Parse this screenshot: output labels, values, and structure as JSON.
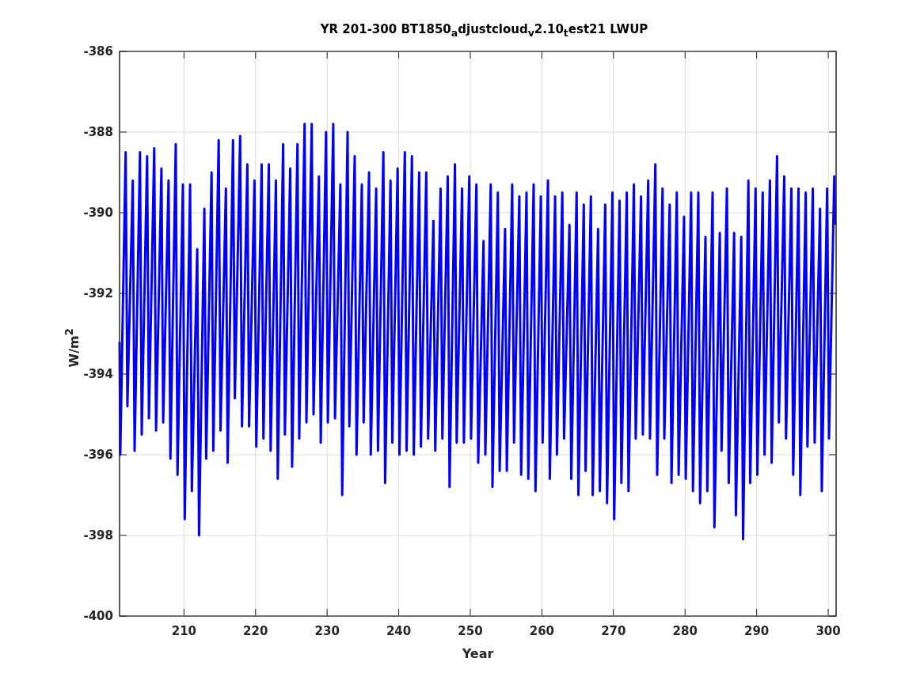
{
  "figure": {
    "chart_data": {
      "type": "line",
      "title": "YR 201-300 BT1850$_{a}$djustcloud$_{v}$2.10$_{t}$est21 LWUP",
      "xlabel": "Year",
      "ylabel": "W/m$^{2}$",
      "x": [
        201,
        201.1,
        201.85,
        202.1,
        202.85,
        203.1,
        203.85,
        204.1,
        204.85,
        205.1,
        205.85,
        206.1,
        206.85,
        207.1,
        207.85,
        208.1,
        208.85,
        209.1,
        209.85,
        210.1,
        210.85,
        211.1,
        211.85,
        212.1,
        212.85,
        213.1,
        213.85,
        214.1,
        214.85,
        215.1,
        215.85,
        216.1,
        216.85,
        217.1,
        217.85,
        218.1,
        218.85,
        219.1,
        219.85,
        220.1,
        220.85,
        221.1,
        221.85,
        222.1,
        222.85,
        223.1,
        223.85,
        224.1,
        224.85,
        225.1,
        225.85,
        226.1,
        226.85,
        227.1,
        227.85,
        228.1,
        228.85,
        229.1,
        229.85,
        230.1,
        230.85,
        231.1,
        231.85,
        232.1,
        232.85,
        233.1,
        233.85,
        234.1,
        234.85,
        235.1,
        235.85,
        236.1,
        236.85,
        237.1,
        237.85,
        238.1,
        238.85,
        239.1,
        239.85,
        240.1,
        240.85,
        241.1,
        241.85,
        242.1,
        242.85,
        243.1,
        243.85,
        244.1,
        244.85,
        245.1,
        245.85,
        246.1,
        246.85,
        247.1,
        247.85,
        248.1,
        248.85,
        249.1,
        249.85,
        250.1,
        250.85,
        251.1,
        251.85,
        252.1,
        252.85,
        253.1,
        253.85,
        254.1,
        254.85,
        255.1,
        255.85,
        256.1,
        256.85,
        257.1,
        257.85,
        258.1,
        258.85,
        259.1,
        259.85,
        260.1,
        260.85,
        261.1,
        261.85,
        262.1,
        262.85,
        263.1,
        263.85,
        264.1,
        264.85,
        265.1,
        265.85,
        266.1,
        266.85,
        267.1,
        267.85,
        268.1,
        268.85,
        269.1,
        269.85,
        270.1,
        270.85,
        271.1,
        271.85,
        272.1,
        272.85,
        273.1,
        273.85,
        274.1,
        274.85,
        275.1,
        275.85,
        276.1,
        276.85,
        277.1,
        277.85,
        278.1,
        278.85,
        279.1,
        279.85,
        280.1,
        280.85,
        281.1,
        281.85,
        282.1,
        282.85,
        283.1,
        283.85,
        284.1,
        284.85,
        285.1,
        285.85,
        286.1,
        286.85,
        287.1,
        287.85,
        288.1,
        288.85,
        289.1,
        289.85,
        290.1,
        290.85,
        291.1,
        291.85,
        292.1,
        292.85,
        293.1,
        293.85,
        294.1,
        294.85,
        295.1,
        295.85,
        296.1,
        296.85,
        297.1,
        297.85,
        298.1,
        298.85,
        299.1,
        299.85,
        300.1,
        300.85,
        300.95
      ],
      "series": [
        {
          "color": "#0000ff",
          "values": [
            -393.2,
            -396,
            -388.5,
            -394.8,
            -389.2,
            -395.9,
            -388.5,
            -395.5,
            -388.6,
            -395.1,
            -388.4,
            -395.4,
            -388.9,
            -395.2,
            -389.2,
            -396.1,
            -388.3,
            -396.5,
            -389.3,
            -397.6,
            -389.3,
            -396.9,
            -390.9,
            -398,
            -389.9,
            -396.1,
            -389,
            -395.9,
            -388.2,
            -395.4,
            -389.4,
            -396.2,
            -388.2,
            -394.6,
            -388.1,
            -395.3,
            -388.8,
            -395.3,
            -389.2,
            -395.8,
            -388.8,
            -395.6,
            -388.8,
            -395.9,
            -389.2,
            -396.6,
            -388.3,
            -395.5,
            -388.9,
            -396.3,
            -388.3,
            -395.6,
            -387.8,
            -395.2,
            -387.8,
            -395,
            -389.1,
            -395.7,
            -388,
            -395.2,
            -387.8,
            -395.1,
            -389.3,
            -397,
            -388,
            -395.3,
            -388.6,
            -396,
            -389.3,
            -395.2,
            -389,
            -396,
            -389.4,
            -395.9,
            -388.5,
            -396.7,
            -389.2,
            -395.7,
            -388.9,
            -396,
            -388.5,
            -395.9,
            -388.6,
            -396,
            -389,
            -395.8,
            -389,
            -395.6,
            -390.2,
            -395.9,
            -389.4,
            -395.6,
            -389.1,
            -396.8,
            -388.8,
            -395.7,
            -389.4,
            -395.7,
            -389.1,
            -395.6,
            -389.3,
            -396.2,
            -390.7,
            -396,
            -389.3,
            -396.8,
            -389.5,
            -396.4,
            -390.4,
            -396.4,
            -389.3,
            -395.7,
            -389.6,
            -396.5,
            -389.5,
            -396.6,
            -389.3,
            -396.9,
            -389.6,
            -395.7,
            -389.2,
            -396.6,
            -389.6,
            -396,
            -389.5,
            -395.6,
            -390.3,
            -396.6,
            -389.5,
            -397,
            -389.8,
            -396.4,
            -389.6,
            -397,
            -390.4,
            -396.9,
            -389.8,
            -397.2,
            -389.5,
            -397.6,
            -389.7,
            -396.7,
            -389.5,
            -396.9,
            -389.3,
            -395.6,
            -389.6,
            -395.5,
            -389.2,
            -395.6,
            -388.8,
            -396.5,
            -389.4,
            -395.6,
            -389.8,
            -396.7,
            -389.5,
            -396.5,
            -390.1,
            -396.6,
            -389.5,
            -396.9,
            -389.5,
            -397.2,
            -390.6,
            -396.9,
            -389.5,
            -397.8,
            -390.5,
            -395.9,
            -389.4,
            -396.7,
            -390.5,
            -397.5,
            -390.6,
            -398.1,
            -389.2,
            -396.7,
            -389.4,
            -396.5,
            -389.5,
            -396,
            -389.2,
            -396.2,
            -388.6,
            -395.2,
            -389.1,
            -395.6,
            -389.4,
            -396.5,
            -389.4,
            -397,
            -389.5,
            -395.8,
            -389.4,
            -395.7,
            -389.9,
            -396.9,
            -389.4,
            -395.6,
            -389.1,
            -390.3
          ]
        }
      ],
      "grid": true,
      "xlim": [
        201,
        301.1
      ],
      "ylim": [
        -400,
        -386
      ],
      "xticks": [
        210,
        220,
        230,
        240,
        250,
        260,
        270,
        280,
        290,
        300
      ],
      "yticks": [
        -400,
        -398,
        -396,
        -394,
        -392,
        -390,
        -388,
        -386
      ]
    }
  }
}
